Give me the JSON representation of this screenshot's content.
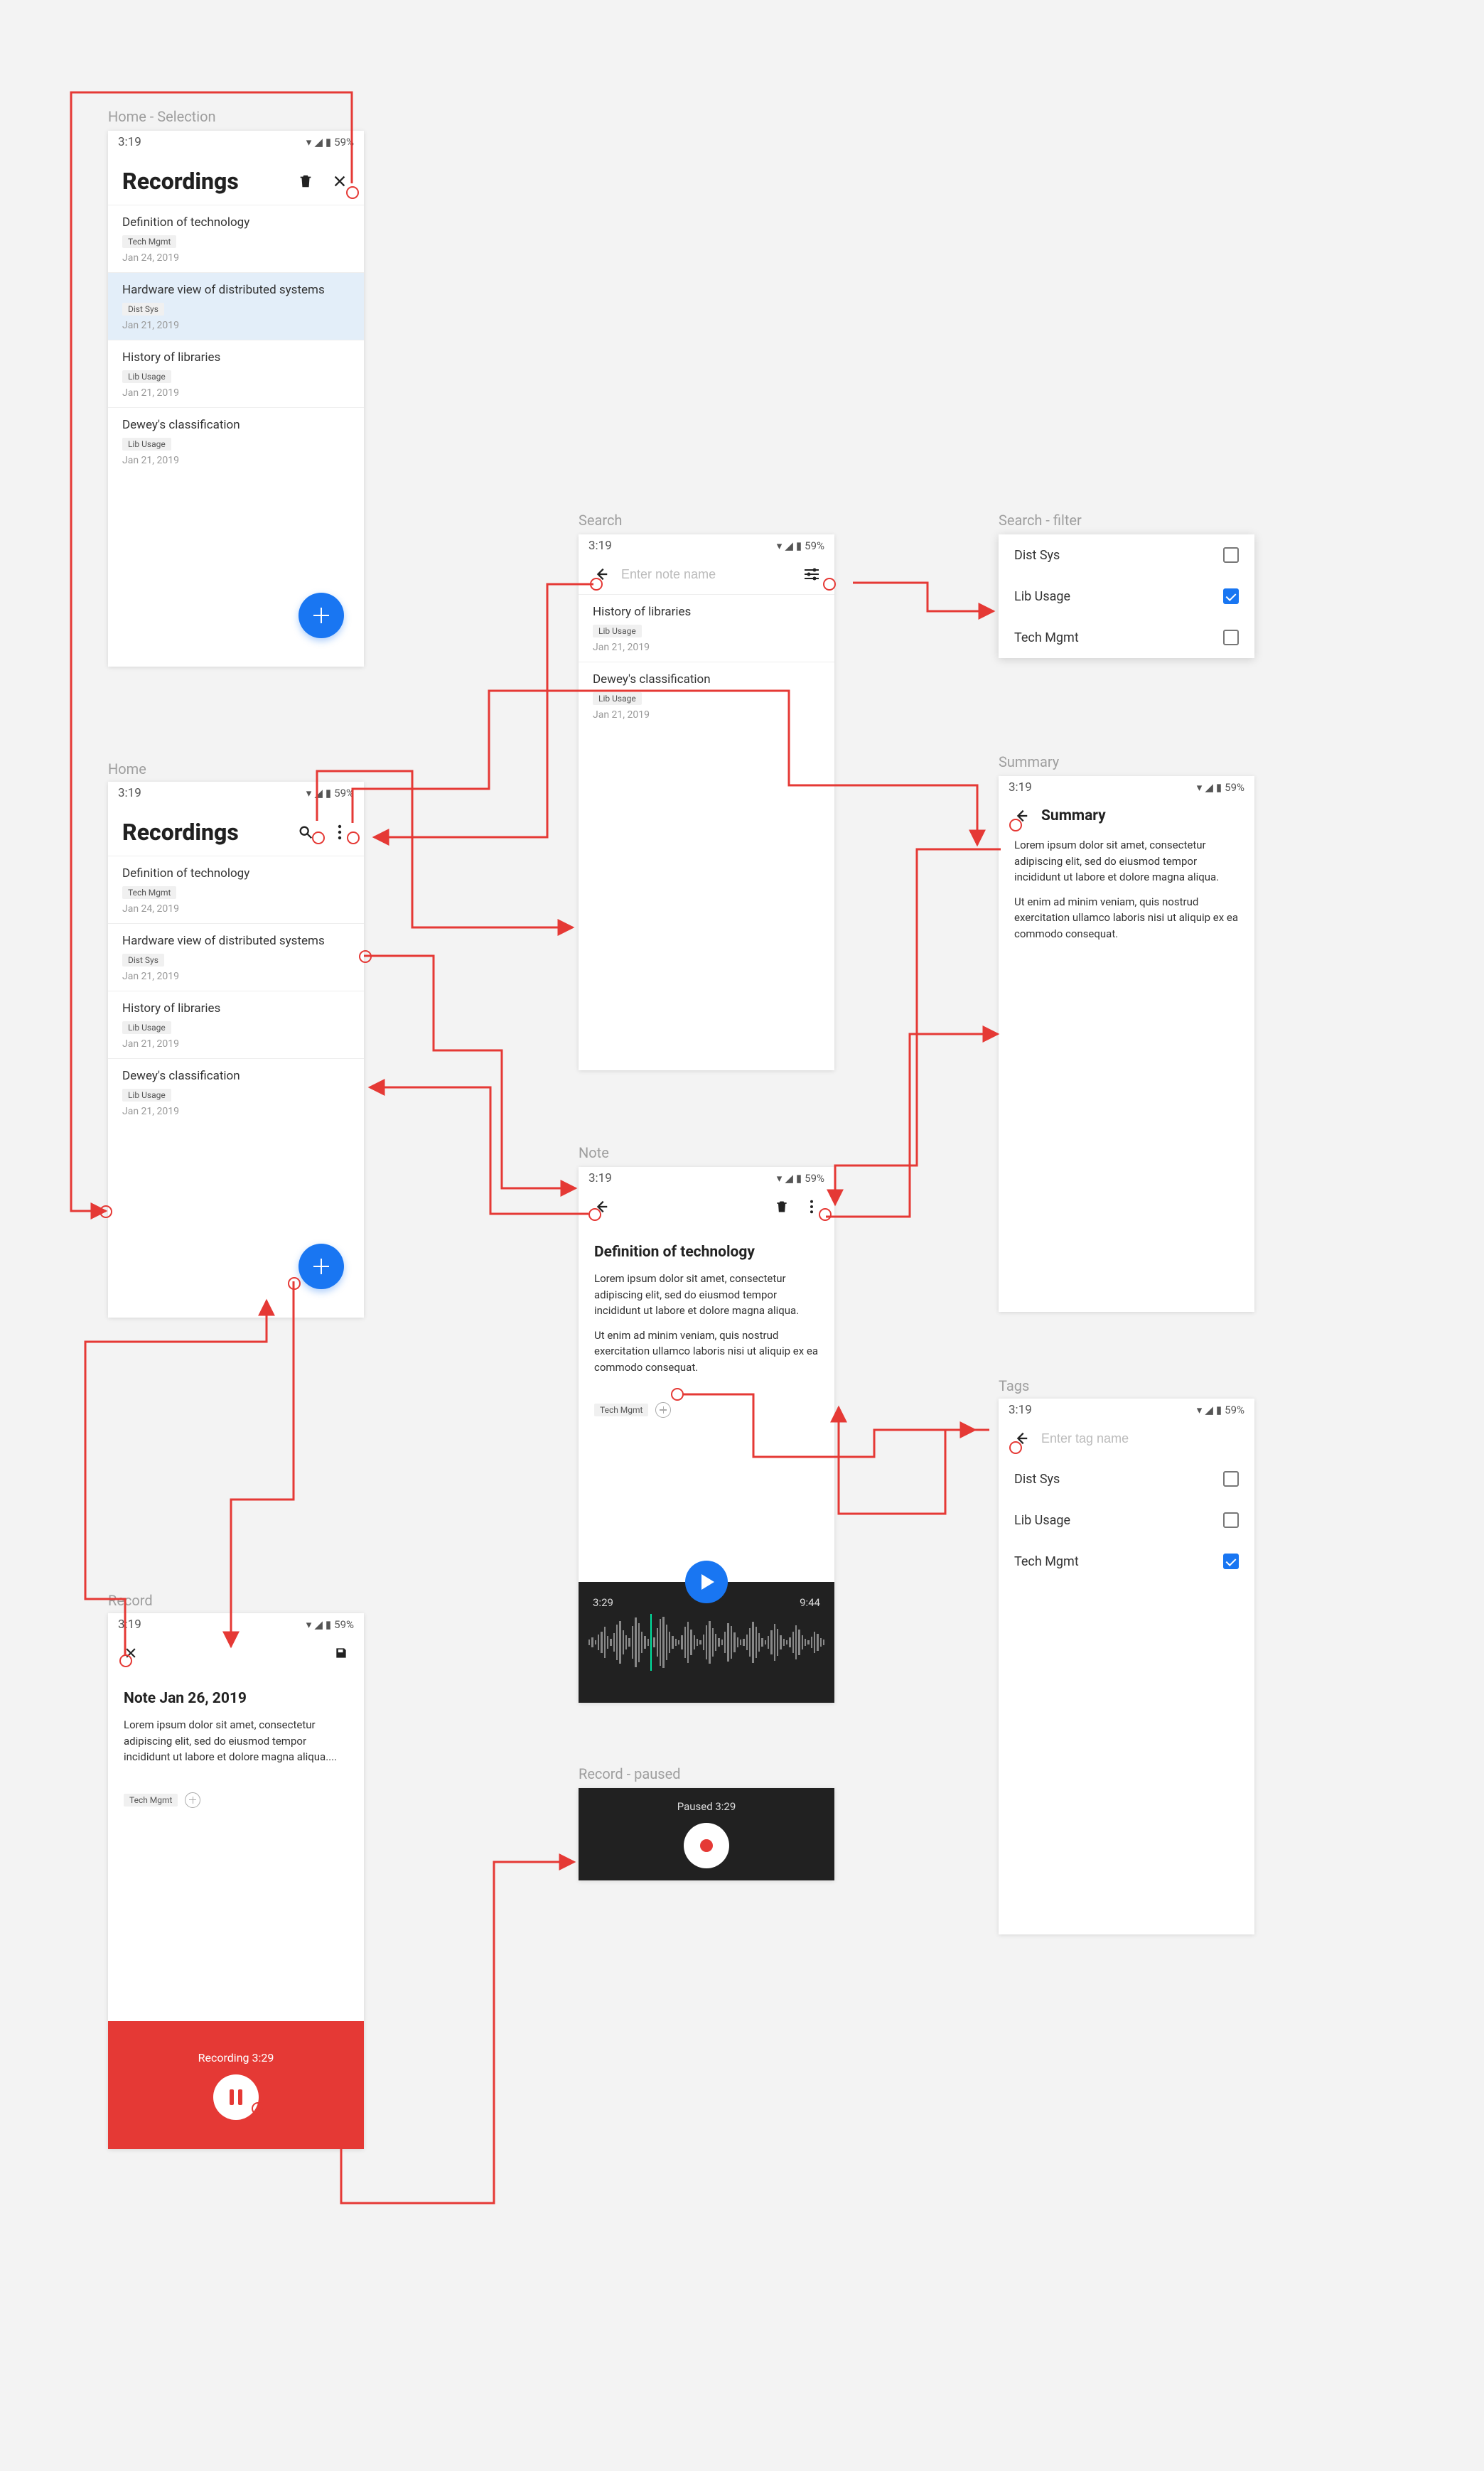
{
  "status": {
    "time": "3:19",
    "battery": "59%"
  },
  "labels": {
    "home_selection": "Home - Selection",
    "home": "Home",
    "search": "Search",
    "search_filter": "Search - filter",
    "summary": "Summary",
    "note": "Note",
    "record": "Record",
    "record_paused": "Record - paused",
    "tags": "Tags"
  },
  "home": {
    "title": "Recordings",
    "items": [
      {
        "title": "Definition of technology",
        "tag": "Tech Mgmt",
        "date": "Jan 24, 2019"
      },
      {
        "title": "Hardware view of distributed systems",
        "tag": "Dist Sys",
        "date": "Jan 21, 2019"
      },
      {
        "title": "History of libraries",
        "tag": "Lib Usage",
        "date": "Jan 21, 2019"
      },
      {
        "title": "Dewey's classification",
        "tag": "Lib Usage",
        "date": "Jan 21, 2019"
      }
    ]
  },
  "search": {
    "placeholder": "Enter note name",
    "results": [
      {
        "title": "History of libraries",
        "tag": "Lib Usage",
        "date": "Jan 21, 2019"
      },
      {
        "title": "Dewey's classification",
        "tag": "Lib Usage",
        "date": "Jan 21, 2019"
      }
    ]
  },
  "filter": {
    "options": [
      {
        "label": "Dist Sys",
        "checked": false
      },
      {
        "label": "Lib Usage",
        "checked": true
      },
      {
        "label": "Tech Mgmt",
        "checked": false
      }
    ]
  },
  "summary": {
    "title": "Summary",
    "p1": "Lorem ipsum dolor sit amet, consectetur adipiscing elit, sed do eiusmod tempor incididunt ut labore et dolore magna aliqua.",
    "p2": "Ut enim ad minim veniam, quis nostrud exercitation ullamco laboris nisi ut aliquip ex ea commodo consequat."
  },
  "note": {
    "title": "Definition of technology",
    "p1": "Lorem ipsum dolor sit amet, consectetur adipiscing elit, sed do eiusmod tempor incididunt ut labore et dolore magna aliqua.",
    "p2": "Ut enim ad minim veniam, quis nostrud exercitation ullamco laboris nisi ut aliquip ex ea commodo consequat.",
    "tag": "Tech Mgmt",
    "player": {
      "current": "3:29",
      "total": "9:44"
    }
  },
  "record": {
    "title": "Note Jan 26, 2019",
    "body": "Lorem ipsum dolor sit amet, consectetur adipiscing elit, sed do eiusmod tempor incididunt ut labore et dolore magna aliqua....",
    "tag": "Tech Mgmt",
    "recording_label": "Recording 3:29",
    "paused_label": "Paused 3:29"
  },
  "tags": {
    "placeholder": "Enter tag name",
    "options": [
      {
        "label": "Dist Sys",
        "checked": false
      },
      {
        "label": "Lib Usage",
        "checked": false
      },
      {
        "label": "Tech Mgmt",
        "checked": true
      }
    ]
  }
}
